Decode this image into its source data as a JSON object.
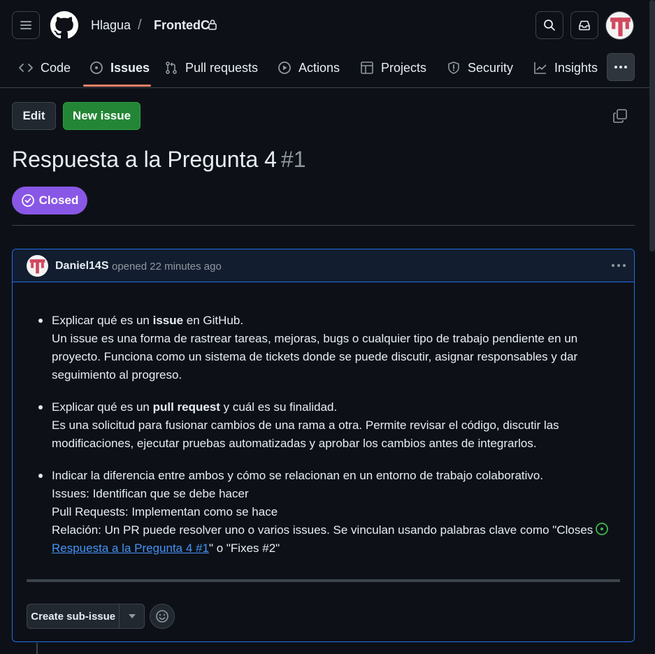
{
  "header": {
    "owner": "Hlagua",
    "separator": "/",
    "repo": "FrontedC"
  },
  "nav": {
    "tabs": [
      {
        "label": "Code",
        "icon": "code-icon"
      },
      {
        "label": "Issues",
        "icon": "issue-opened-icon",
        "active": true
      },
      {
        "label": "Pull requests",
        "icon": "git-pull-request-icon"
      },
      {
        "label": "Actions",
        "icon": "play-icon"
      },
      {
        "label": "Projects",
        "icon": "table-icon"
      },
      {
        "label": "Security",
        "icon": "shield-icon"
      },
      {
        "label": "Insights",
        "icon": "graph-icon"
      }
    ],
    "active_color": "#f78166"
  },
  "actions": {
    "edit_label": "Edit",
    "new_issue_label": "New issue"
  },
  "issue": {
    "title": "Respuesta a la Pregunta 4",
    "number": "#1",
    "state": "Closed",
    "state_color": "#8957e5"
  },
  "comment": {
    "author": "Daniel14S",
    "meta": "opened 22 minutes ago",
    "items": [
      {
        "lead_pre": "Explicar qué es un ",
        "lead_bold": "issue",
        "lead_post": " en GitHub.",
        "body": "Un issue es una forma de rastrear tareas, mejoras, bugs o cualquier tipo de trabajo pendiente en un proyecto. Funciona como un sistema de tickets donde se puede discutir, asignar responsables y dar seguimiento al progreso."
      },
      {
        "lead_pre": "Explicar qué es un ",
        "lead_bold": "pull request",
        "lead_post": " y cuál es su finalidad.",
        "body": "Es una solicitud para fusionar cambios de una rama a otra. Permite revisar el código, discutir las modificaciones, ejecutar pruebas automatizadas y aprobar los cambios antes de integrarlos."
      }
    ],
    "third": {
      "lead": "Indicar la diferencia entre ambos y cómo se relacionan en un entorno de trabajo colaborativo.",
      "line1": "Issues: Identifican que se debe hacer",
      "line2": "Pull Requests: Implementan como se hace",
      "line3_pre": "Relación: Un PR puede resolver uno o varios issues. Se vinculan usando palabras clave como \"Closes",
      "link_text": "Respuesta a la Pregunta 4 #1",
      "line3_post": "\" o \"Fixes #2\""
    }
  },
  "footer": {
    "sub_issue_label": "Create sub-issue"
  }
}
